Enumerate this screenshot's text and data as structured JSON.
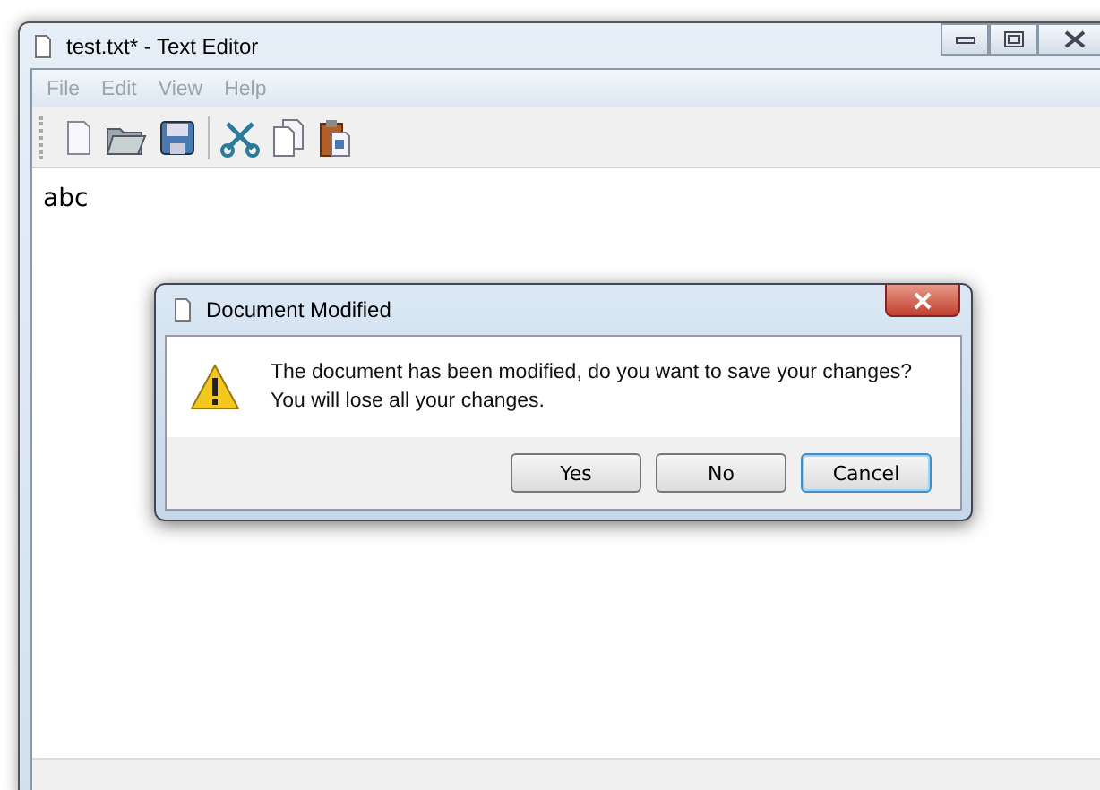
{
  "window": {
    "title": "test.txt* - Text Editor"
  },
  "menu": [
    {
      "label": "File",
      "disabled": true
    },
    {
      "label": "Edit",
      "disabled": true
    },
    {
      "label": "View",
      "disabled": true
    },
    {
      "label": "Help",
      "disabled": true
    }
  ],
  "editor": {
    "value": "abc"
  },
  "dialog": {
    "title": "Document Modified",
    "message": "The document has been modified, do you want to save your changes?\nYou will lose all your changes.",
    "buttons": [
      {
        "label": "Yes",
        "default": false
      },
      {
        "label": "No",
        "default": false
      },
      {
        "label": "Cancel",
        "default": true
      }
    ]
  }
}
